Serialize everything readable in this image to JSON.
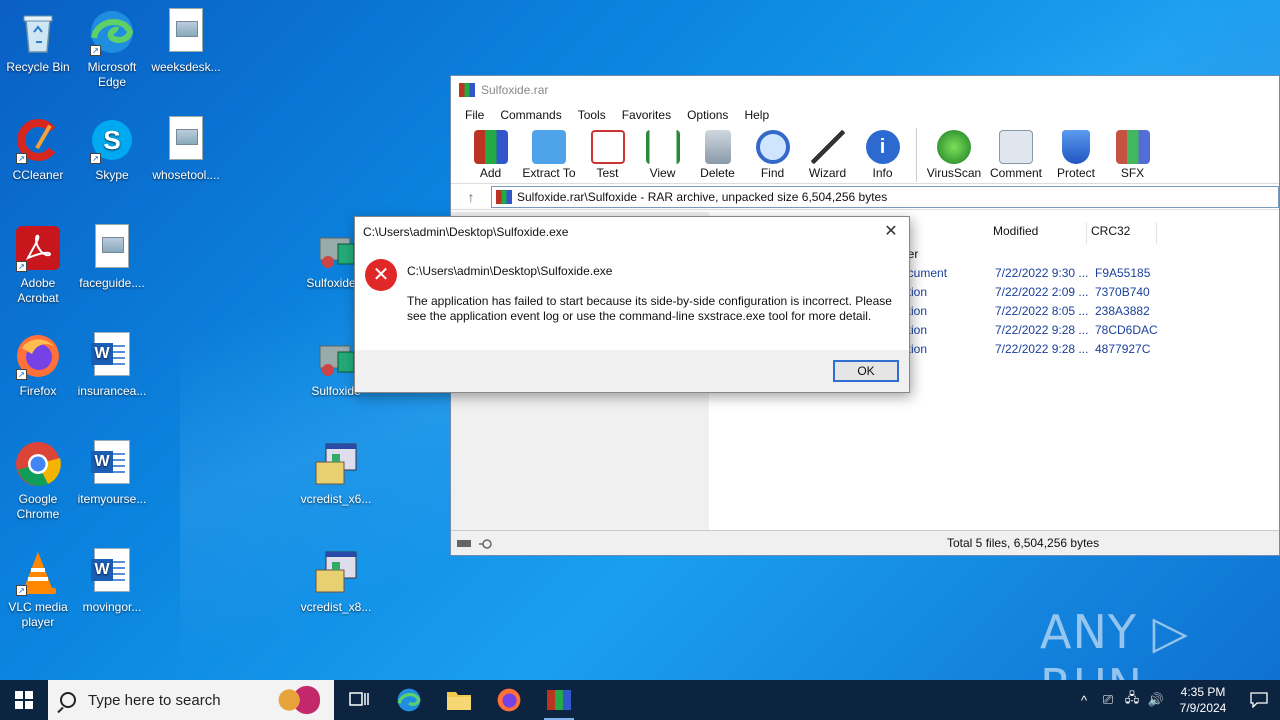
{
  "desktop": {
    "icons": [
      {
        "label": "Recycle Bin"
      },
      {
        "label": "Microsoft Edge"
      },
      {
        "label": "weeksdesk..."
      },
      {
        "label": "CCleaner"
      },
      {
        "label": "Skype"
      },
      {
        "label": "whosetool...."
      },
      {
        "label": "Adobe Acrobat"
      },
      {
        "label": "faceguide...."
      },
      {
        "label": "Sulfoxide..."
      },
      {
        "label": "Firefox"
      },
      {
        "label": "insurancea..."
      },
      {
        "label": "Sulfoxide"
      },
      {
        "label": "Google Chrome"
      },
      {
        "label": "itemyourse..."
      },
      {
        "label": "vcredist_x6..."
      },
      {
        "label": "VLC media player"
      },
      {
        "label": "movingor..."
      },
      {
        "label": "vcredist_x8..."
      }
    ]
  },
  "winrar": {
    "title": "Sulfoxide.rar",
    "menu": [
      "File",
      "Commands",
      "Tools",
      "Favorites",
      "Options",
      "Help"
    ],
    "toolbar": [
      "Add",
      "Extract To",
      "Test",
      "View",
      "Delete",
      "Find",
      "Wizard",
      "Info",
      "VirusScan",
      "Comment",
      "Protect",
      "SFX"
    ],
    "path": "Sulfoxide.rar\\Sulfoxide - RAR archive, unpacked size 6,504,256 bytes",
    "columns": {
      "modified": "Modified",
      "crc": "CRC32"
    },
    "type_partials": [
      "der",
      "ocument",
      "ation",
      "ation",
      "ation",
      "ation"
    ],
    "rows": [
      {
        "modified": "7/22/2022 9:30 ...",
        "crc": "F9A55185"
      },
      {
        "modified": "7/22/2022 2:09 ...",
        "crc": "7370B740"
      },
      {
        "modified": "7/22/2022 8:05 ...",
        "crc": "238A3882"
      },
      {
        "modified": "7/22/2022 9:28 ...",
        "crc": "78CD6DAC"
      },
      {
        "modified": "7/22/2022 9:28 ...",
        "crc": "4877927C"
      }
    ],
    "status": "Total 5 files, 6,504,256 bytes"
  },
  "dialog": {
    "title": "C:\\Users\\admin\\Desktop\\Sulfoxide.exe",
    "heading": "C:\\Users\\admin\\Desktop\\Sulfoxide.exe",
    "message": "The application has failed to start because its side-by-side configuration is incorrect. Please see the application event log or use the command-line sxstrace.exe tool for more detail.",
    "ok_label": "OK",
    "close_glyph": "✕"
  },
  "watermark": "ANY ▷ RUN",
  "taskbar": {
    "search_placeholder": "Type here to search",
    "time": "4:35 PM",
    "date": "7/9/2024"
  },
  "colors": {
    "error": "#e02828",
    "accent": "#2f6fd4",
    "taskbar": "#0d2440"
  }
}
